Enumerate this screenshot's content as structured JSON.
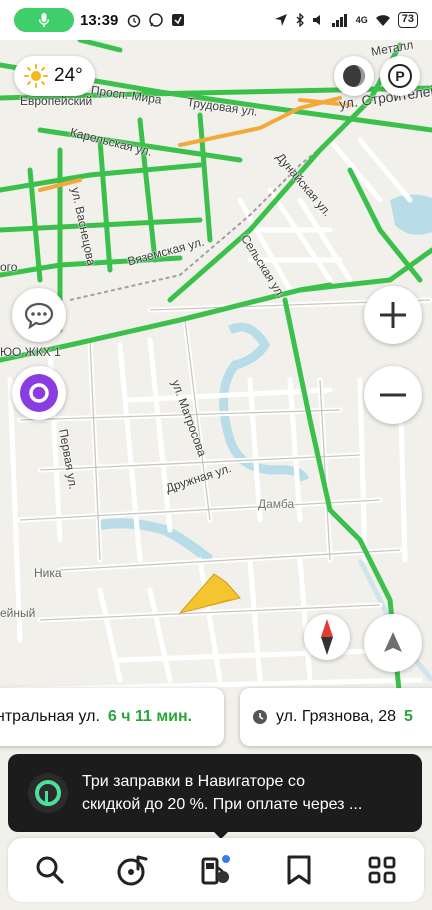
{
  "status_bar": {
    "time": "13:39",
    "network": "4G",
    "battery": "73",
    "left_icons": [
      "mic-icon",
      "alarm-icon",
      "whatsapp-icon",
      "app-notification-icon"
    ],
    "right_icons": [
      "location-icon",
      "bluetooth-icon",
      "volume-icon",
      "signal-icon",
      "wifi-icon",
      "battery-icon"
    ]
  },
  "weather": {
    "temperature": "24°",
    "icon": "sun-icon"
  },
  "map": {
    "labels": {
      "pr_mira": "Просп. Мира",
      "evropeiskiy": "Европейский",
      "trudovaya": "Трудовая ул.",
      "stroiteley": "ул. Строителей",
      "metall": "Металл",
      "karelskaya": "Карельская ул.",
      "vasnetsova": "ул. Васнецова",
      "vyazemskaya": "Вяземская ул.",
      "dunayskaya": "Дунайская ул.",
      "selskaya": "Сельская ул.",
      "zhkh": "ЮО ЖКХ 1",
      "ogo": "ого",
      "matrosova": "ул. Матросова",
      "pervaya": "Первая ул.",
      "druzhnaya": "Дружная ул.",
      "damba": "Дамба",
      "nika": "Ника",
      "eyniy": "ейный"
    }
  },
  "controls": {
    "layers": "layers-icon",
    "parking": "P",
    "chat": "chat-icon",
    "alice": "alice-icon",
    "zoom_in": "plus-icon",
    "zoom_out": "minus-icon",
    "compass": "compass-icon",
    "navigate": "navigation-arrow-icon"
  },
  "routes": [
    {
      "street": "нтральная ул.",
      "time": "6 ч 11 мин."
    },
    {
      "street": "ул. Грязнова, 28",
      "time": "5"
    }
  ],
  "ad": {
    "text_line1": "Три заправки в Навигаторе со",
    "text_line2": "скидкой  до 20 %. При оплате через ..."
  },
  "bottom_nav": [
    {
      "name": "search",
      "icon": "search-icon"
    },
    {
      "name": "music",
      "icon": "music-icon"
    },
    {
      "name": "gas-station",
      "icon": "gas-station-icon"
    },
    {
      "name": "bookmarks",
      "icon": "bookmark-icon"
    },
    {
      "name": "menu",
      "icon": "grid-icon"
    }
  ],
  "colors": {
    "road_green": "#3cc04c",
    "road_orange": "#f3a93a",
    "water": "#b8dde8",
    "map_bg": "#f2f0eb",
    "arrow": "#f5c531",
    "alice": "#8a3ce0"
  }
}
